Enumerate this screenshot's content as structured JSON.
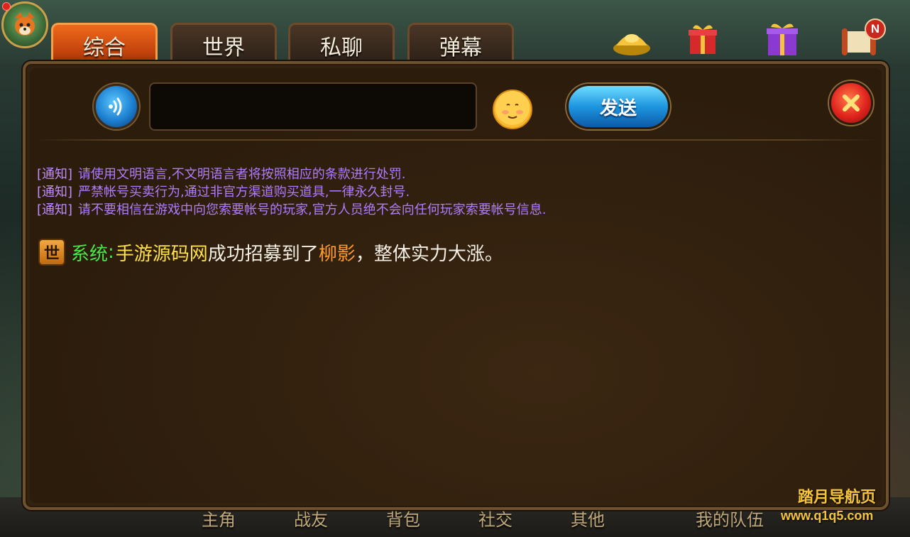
{
  "tabs": [
    {
      "label": "综合",
      "active": true
    },
    {
      "label": "世界",
      "active": false
    },
    {
      "label": "私聊",
      "active": false
    },
    {
      "label": "弹幕",
      "active": false
    }
  ],
  "top_right": {
    "notification_badge": "N"
  },
  "chat_input": {
    "value": "",
    "placeholder": ""
  },
  "send_label": "发送",
  "notices": [
    {
      "tag": "[通知]",
      "text": "请使用文明语言,不文明语言者将按照相应的条款进行处罚."
    },
    {
      "tag": "[通知]",
      "text": "严禁帐号买卖行为,通过非官方渠道购买道具,一律永久封号."
    },
    {
      "tag": "[通知]",
      "text": "请不要相信在游戏中向您索要帐号的玩家,官方人员绝不会向任何玩家索要帐号信息."
    }
  ],
  "system_message": {
    "channel_badge": "世",
    "sender": "系统",
    "colon": ":",
    "player": "手游源码网",
    "text_before_hero": "成功招募到了",
    "hero": "柳影",
    "text_after_hero": "，整体实力大涨。"
  },
  "bottom_menu": [
    "主角",
    "战友",
    "背包",
    "社交",
    "其他",
    "我的队伍"
  ],
  "watermark": {
    "line1": "踏月导航页",
    "line2": "www.q1q5.com"
  },
  "colors": {
    "notice_purple": "#b07cff",
    "system_green": "#48e848",
    "player_yellow": "#ffe14a",
    "hero_orange": "#ff9a2a",
    "active_tab_orange": "#f06a1c",
    "send_blue": "#1e96e0",
    "close_red": "#e0231d"
  },
  "icons": {
    "avatar": "fox-avatar-icon",
    "voice": "voice-wave-icon",
    "emoji": "smiley-face-icon",
    "close": "close-x-icon",
    "events": [
      "gold-ingot-icon",
      "gift-box-icon",
      "purple-gift-icon",
      "scroll-icon"
    ]
  }
}
